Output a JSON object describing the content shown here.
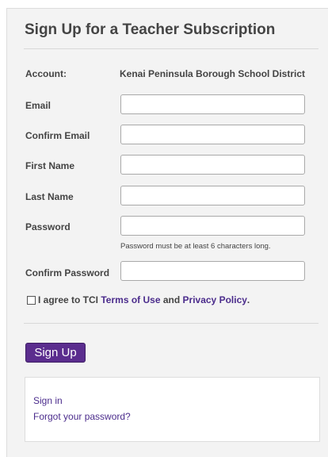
{
  "form": {
    "title": "Sign Up for a Teacher Subscription",
    "account": {
      "label": "Account:",
      "value": "Kenai Peninsula Borough School District"
    },
    "fields": {
      "email": {
        "label": "Email",
        "value": "",
        "placeholder": ""
      },
      "confirm_email": {
        "label": "Confirm Email",
        "value": "",
        "placeholder": ""
      },
      "first_name": {
        "label": "First Name",
        "value": "",
        "placeholder": ""
      },
      "last_name": {
        "label": "Last Name",
        "value": "",
        "placeholder": ""
      },
      "password": {
        "label": "Password",
        "value": "",
        "placeholder": "",
        "hint": "Password must be at least 6 characters long."
      },
      "confirm_password": {
        "label": "Confirm Password",
        "value": "",
        "placeholder": ""
      }
    },
    "agreement": {
      "checked": false,
      "prefix": "I agree to TCI",
      "terms_link": "Terms of Use",
      "conjunction": "and",
      "privacy_link": "Privacy Policy",
      "suffix": "."
    },
    "submit_label": "Sign Up"
  },
  "links": {
    "sign_in": "Sign in",
    "forgot_password": "Forgot your password?"
  },
  "colors": {
    "brand": "#5b2d8e",
    "link": "#4b2c8c",
    "panel_background": "#f3f3f3",
    "text": "#444444"
  }
}
